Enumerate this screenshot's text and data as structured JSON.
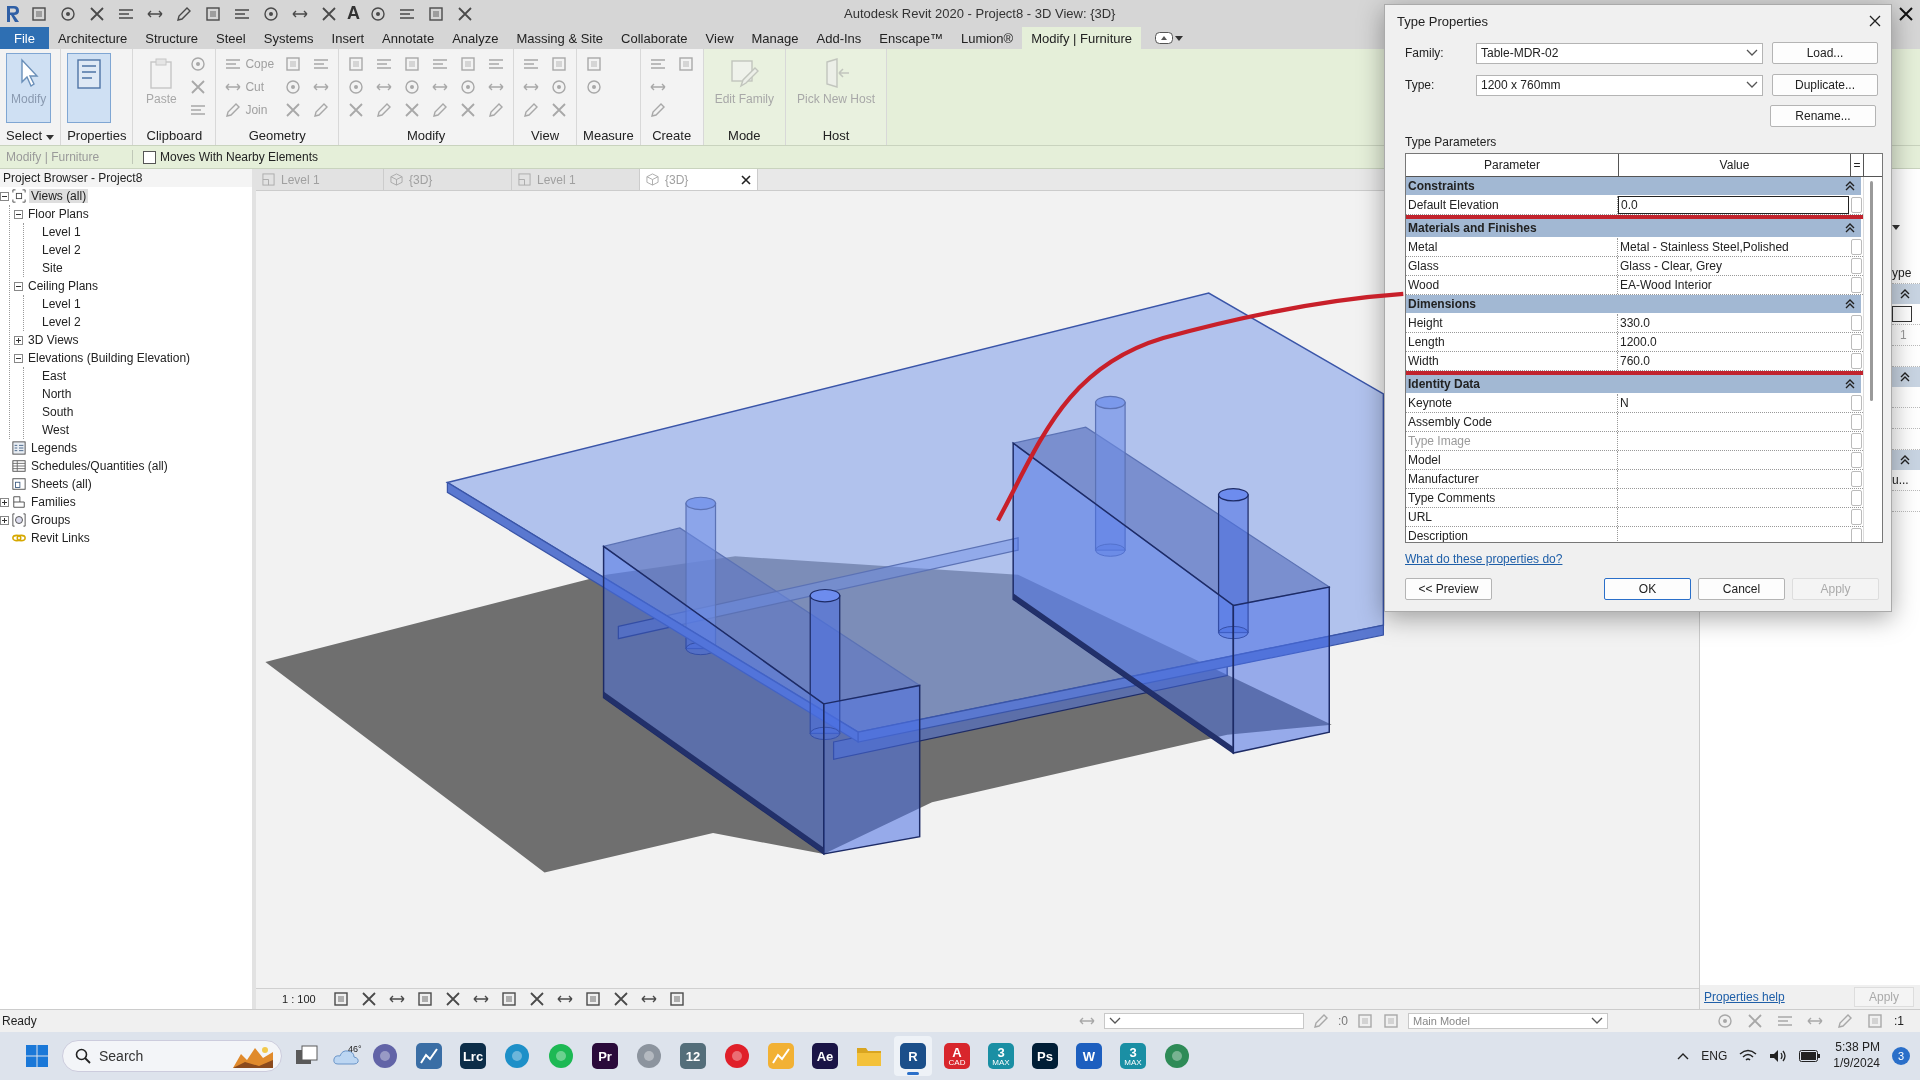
{
  "title_bar": {
    "text_tool": "A",
    "title": "Autodesk Revit 2020 - Project8 - 3D View: {3D}"
  },
  "ribbon_tabs": [
    {
      "label": "File",
      "kind": "file",
      "selected": false
    },
    {
      "label": "Architecture",
      "kind": "tab",
      "selected": false
    },
    {
      "label": "Structure",
      "kind": "tab",
      "selected": false
    },
    {
      "label": "Steel",
      "kind": "tab",
      "selected": false
    },
    {
      "label": "Systems",
      "kind": "tab",
      "selected": false
    },
    {
      "label": "Insert",
      "kind": "tab",
      "selected": false
    },
    {
      "label": "Annotate",
      "kind": "tab",
      "selected": false
    },
    {
      "label": "Analyze",
      "kind": "tab",
      "selected": false
    },
    {
      "label": "Massing & Site",
      "kind": "tab",
      "selected": false
    },
    {
      "label": "Collaborate",
      "kind": "tab",
      "selected": false
    },
    {
      "label": "View",
      "kind": "tab",
      "selected": false
    },
    {
      "label": "Manage",
      "kind": "tab",
      "selected": false
    },
    {
      "label": "Add-Ins",
      "kind": "tab",
      "selected": false
    },
    {
      "label": "Enscape™",
      "kind": "tab",
      "selected": false
    },
    {
      "label": "Lumion®",
      "kind": "tab",
      "selected": false
    },
    {
      "label": "Modify | Furniture",
      "kind": "tab",
      "selected": true
    }
  ],
  "ribbon_panels": [
    {
      "title": "Select",
      "menu": true,
      "contextual": false,
      "tools": [
        {
          "kind": "large",
          "label": "Modify",
          "selected": true,
          "disabled": false
        }
      ]
    },
    {
      "title": "Properties",
      "menu": false,
      "contextual": false,
      "tools": [
        {
          "kind": "large",
          "selected": true,
          "disabled": false
        }
      ]
    },
    {
      "title": "Clipboard",
      "menu": false,
      "contextual": false,
      "tools": [
        {
          "kind": "large",
          "label": "Paste",
          "selected": false,
          "disabled": true
        },
        {
          "kind": "icon",
          "selected": false,
          "disabled": true
        },
        {
          "kind": "icon",
          "selected": false,
          "disabled": true
        },
        {
          "kind": "icon",
          "selected": false,
          "disabled": true
        }
      ]
    },
    {
      "title": "Geometry",
      "menu": false,
      "contextual": false,
      "tools": [
        {
          "kind": "small",
          "label": "Cope",
          "selected": false,
          "disabled": true
        },
        {
          "kind": "small",
          "label": "Cut",
          "selected": false,
          "disabled": true
        },
        {
          "kind": "small",
          "label": "Join",
          "selected": false,
          "disabled": true
        },
        {
          "kind": "icon",
          "selected": false,
          "disabled": true
        },
        {
          "kind": "icon",
          "selected": false,
          "disabled": true
        },
        {
          "kind": "icon",
          "selected": false,
          "disabled": true
        },
        {
          "kind": "icon",
          "selected": false,
          "disabled": true
        },
        {
          "kind": "icon",
          "selected": false,
          "disabled": true
        },
        {
          "kind": "icon",
          "selected": false,
          "disabled": true
        }
      ]
    },
    {
      "title": "Modify",
      "menu": false,
      "contextual": false,
      "tools": [
        {
          "kind": "icon",
          "selected": false,
          "disabled": true
        },
        {
          "kind": "icon",
          "selected": false,
          "disabled": true
        },
        {
          "kind": "icon",
          "selected": false,
          "disabled": true
        },
        {
          "kind": "icon",
          "selected": false,
          "disabled": true
        },
        {
          "kind": "icon",
          "selected": false,
          "disabled": true
        },
        {
          "kind": "icon",
          "selected": false,
          "disabled": true
        },
        {
          "kind": "icon",
          "selected": false,
          "disabled": true
        },
        {
          "kind": "icon",
          "selected": false,
          "disabled": true
        },
        {
          "kind": "icon",
          "selected": false,
          "disabled": true
        },
        {
          "kind": "icon",
          "selected": false,
          "disabled": true
        },
        {
          "kind": "icon",
          "selected": false,
          "disabled": true
        },
        {
          "kind": "icon",
          "selected": false,
          "disabled": true
        },
        {
          "kind": "icon",
          "selected": false,
          "disabled": true
        },
        {
          "kind": "icon",
          "selected": false,
          "disabled": true
        },
        {
          "kind": "icon",
          "selected": false,
          "disabled": true
        },
        {
          "kind": "icon",
          "selected": false,
          "disabled": true
        },
        {
          "kind": "icon",
          "selected": false,
          "disabled": true
        },
        {
          "kind": "icon",
          "selected": false,
          "disabled": true
        }
      ]
    },
    {
      "title": "View",
      "menu": false,
      "contextual": false,
      "tools": [
        {
          "kind": "icon",
          "selected": false,
          "disabled": true
        },
        {
          "kind": "icon",
          "selected": false,
          "disabled": true
        },
        {
          "kind": "icon",
          "selected": false,
          "disabled": true
        },
        {
          "kind": "icon",
          "selected": false,
          "disabled": true
        },
        {
          "kind": "icon",
          "selected": false,
          "disabled": true
        },
        {
          "kind": "icon",
          "selected": false,
          "disabled": true
        }
      ]
    },
    {
      "title": "Measure",
      "menu": false,
      "contextual": false,
      "tools": [
        {
          "kind": "icon",
          "selected": false,
          "disabled": true
        },
        {
          "kind": "icon",
          "selected": false,
          "disabled": true
        }
      ]
    },
    {
      "title": "Create",
      "menu": false,
      "contextual": false,
      "tools": [
        {
          "kind": "icon",
          "selected": false,
          "disabled": true
        },
        {
          "kind": "icon",
          "selected": false,
          "disabled": true
        },
        {
          "kind": "icon",
          "selected": false,
          "disabled": true
        },
        {
          "kind": "icon",
          "selected": false,
          "disabled": true
        }
      ]
    },
    {
      "title": "Mode",
      "menu": false,
      "contextual": true,
      "tools": [
        {
          "kind": "large",
          "label": "Edit Family",
          "selected": false,
          "disabled": true
        }
      ]
    },
    {
      "title": "Host",
      "menu": false,
      "contextual": true,
      "tools": [
        {
          "kind": "large",
          "label": "Pick New Host",
          "selected": false,
          "disabled": true
        }
      ]
    }
  ],
  "options_bar": {
    "context": "Modify | Furniture",
    "checkbox": {
      "label": "Moves With Nearby Elements",
      "checked": false
    }
  },
  "project_browser": {
    "title": "Project Browser - Project8",
    "tree": [
      {
        "label": "Views (all)",
        "kind": "views",
        "expanded": true,
        "selected": true,
        "children": [
          {
            "label": "Floor Plans",
            "expanded": true,
            "selected": false,
            "children": [
              {
                "label": "Level 1",
                "selected": false
              },
              {
                "label": "Level 2",
                "selected": false
              },
              {
                "label": "Site",
                "selected": false
              }
            ]
          },
          {
            "label": "Ceiling Plans",
            "expanded": true,
            "selected": false,
            "children": [
              {
                "label": "Level 1",
                "selected": false
              },
              {
                "label": "Level 2",
                "selected": false
              }
            ]
          },
          {
            "label": "3D Views",
            "expanded": false,
            "selected": false
          },
          {
            "label": "Elevations (Building Elevation)",
            "expanded": true,
            "selected": false,
            "children": [
              {
                "label": "East",
                "selected": false
              },
              {
                "label": "North",
                "selected": false
              },
              {
                "label": "South",
                "selected": false
              },
              {
                "label": "West",
                "selected": false
              }
            ]
          }
        ]
      },
      {
        "label": "Legends",
        "kind": "legends",
        "selected": false
      },
      {
        "label": "Schedules/Quantities (all)",
        "kind": "schedules",
        "selected": false
      },
      {
        "label": "Sheets (all)",
        "kind": "sheets",
        "selected": false
      },
      {
        "label": "Families",
        "kind": "families",
        "expanded": false,
        "selected": false
      },
      {
        "label": "Groups",
        "kind": "groups",
        "expanded": false,
        "selected": false
      },
      {
        "label": "Revit Links",
        "kind": "links",
        "selected": false
      }
    ]
  },
  "view_tabs": [
    {
      "label": "Level 1",
      "kind": "plan",
      "selected": false
    },
    {
      "label": "{3D}",
      "kind": "model",
      "selected": false
    },
    {
      "label": "Level 1",
      "kind": "plan",
      "selected": false
    },
    {
      "label": "{3D}",
      "kind": "model",
      "selected": true
    }
  ],
  "view": {
    "scale": "1 : 100"
  },
  "properties_panel": {
    "column_fragment": "ype",
    "value_fragment": "1",
    "name_fragment": "u...",
    "help_link": "Properties help",
    "apply": "Apply"
  },
  "dialog": {
    "title": "Type Properties",
    "family_label": "Family:",
    "family": "Table-MDR-02",
    "type_label": "Type:",
    "type": "1200 x 760mm",
    "side_buttons": [
      "Load...",
      "Duplicate...",
      "Rename..."
    ],
    "section_label": "Type Parameters",
    "columns": [
      "Parameter",
      "Value",
      "="
    ],
    "groups": [
      {
        "name": "Constraints",
        "highlighted": false,
        "rows": [
          {
            "name": "Default Elevation",
            "value": "0.0",
            "editing": true,
            "disabled": false
          }
        ]
      },
      {
        "name": "Materials and Finishes",
        "highlighted": true,
        "rows": [
          {
            "name": "Metal",
            "value": "Metal - Stainless Steel,Polished",
            "editing": false,
            "disabled": false
          },
          {
            "name": "Glass",
            "value": "Glass - Clear, Grey",
            "editing": false,
            "disabled": false
          },
          {
            "name": "Wood",
            "value": "EA-Wood Interior",
            "editing": false,
            "disabled": false
          }
        ]
      },
      {
        "name": "Dimensions",
        "highlighted": true,
        "rows": [
          {
            "name": "Height",
            "value": "330.0",
            "editing": false,
            "disabled": false
          },
          {
            "name": "Length",
            "value": "1200.0",
            "editing": false,
            "disabled": false
          },
          {
            "name": "Width",
            "value": "760.0",
            "editing": false,
            "disabled": false
          }
        ]
      },
      {
        "name": "Identity Data",
        "highlighted": false,
        "rows": [
          {
            "name": "Keynote",
            "value": "N",
            "editing": false,
            "disabled": false
          },
          {
            "name": "Assembly Code",
            "editing": false,
            "disabled": false
          },
          {
            "name": "Type Image",
            "editing": false,
            "disabled": true
          },
          {
            "name": "Model",
            "editing": false,
            "disabled": false
          },
          {
            "name": "Manufacturer",
            "editing": false,
            "disabled": false
          },
          {
            "name": "Type Comments",
            "editing": false,
            "disabled": false
          },
          {
            "name": "URL",
            "editing": false,
            "disabled": false
          },
          {
            "name": "Description",
            "editing": false,
            "disabled": false
          }
        ]
      }
    ],
    "help_link": "What do these properties do?",
    "buttons": [
      {
        "label": "<< Preview",
        "default": false,
        "disabled": false
      },
      {
        "label": "OK",
        "default": true,
        "disabled": false
      },
      {
        "label": "Cancel",
        "default": false,
        "disabled": false
      },
      {
        "label": "Apply",
        "default": false,
        "disabled": true
      }
    ]
  },
  "status_bar": {
    "text": "Ready",
    "active_count": ":0",
    "model": "Main Model",
    "filter_count": ":1"
  },
  "taskbar": {
    "search": "Search",
    "weather": "46°",
    "apps": [
      {
        "kind": "taskview",
        "color": "#5a5a5a",
        "selected": false
      },
      {
        "kind": "circle",
        "color": "#6264a7",
        "selected": false
      },
      {
        "kind": "tile",
        "color": "#3a6ea5",
        "selected": false
      },
      {
        "kind": "tile",
        "color": "#0c2d48",
        "label": "Lrc",
        "selected": false
      },
      {
        "kind": "circle",
        "color": "#1e90c8",
        "selected": false
      },
      {
        "kind": "circle",
        "color": "#1db954",
        "selected": false
      },
      {
        "kind": "tile",
        "color": "#2a0a3a",
        "label": "Pr",
        "selected": false
      },
      {
        "kind": "circle",
        "color": "#8c949e",
        "selected": false
      },
      {
        "kind": "tile",
        "color": "#546e7a",
        "label": "12",
        "selected": false
      },
      {
        "kind": "circle",
        "color": "#e0202a",
        "selected": false
      },
      {
        "kind": "tile",
        "color": "#f2b134",
        "selected": false
      },
      {
        "kind": "tile",
        "color": "#1a1446",
        "label": "Ae",
        "selected": false
      },
      {
        "kind": "folder",
        "color": "#f3c13a",
        "selected": false
      },
      {
        "kind": "tile",
        "color": "#1b4f8a",
        "label": "R",
        "selected": true
      },
      {
        "kind": "tile",
        "color": "#d8262c",
        "label": "A",
        "sublabel": "CAD",
        "selected": false
      },
      {
        "kind": "tile",
        "color": "#1a8fa4",
        "label": "3",
        "sublabel": "MAX",
        "selected": false
      },
      {
        "kind": "tile",
        "color": "#001e36",
        "label": "Ps",
        "selected": false
      },
      {
        "kind": "tile",
        "color": "#1d5fbf",
        "label": "W",
        "selected": false
      },
      {
        "kind": "tile",
        "color": "#1a8fa4",
        "label": "3",
        "sublabel": "MAX",
        "selected": false
      },
      {
        "kind": "circle",
        "color": "#2e8b57",
        "selected": false
      }
    ],
    "language": "ENG",
    "time": "5:38 PM",
    "date": "1/9/2024",
    "notifications": "3"
  }
}
